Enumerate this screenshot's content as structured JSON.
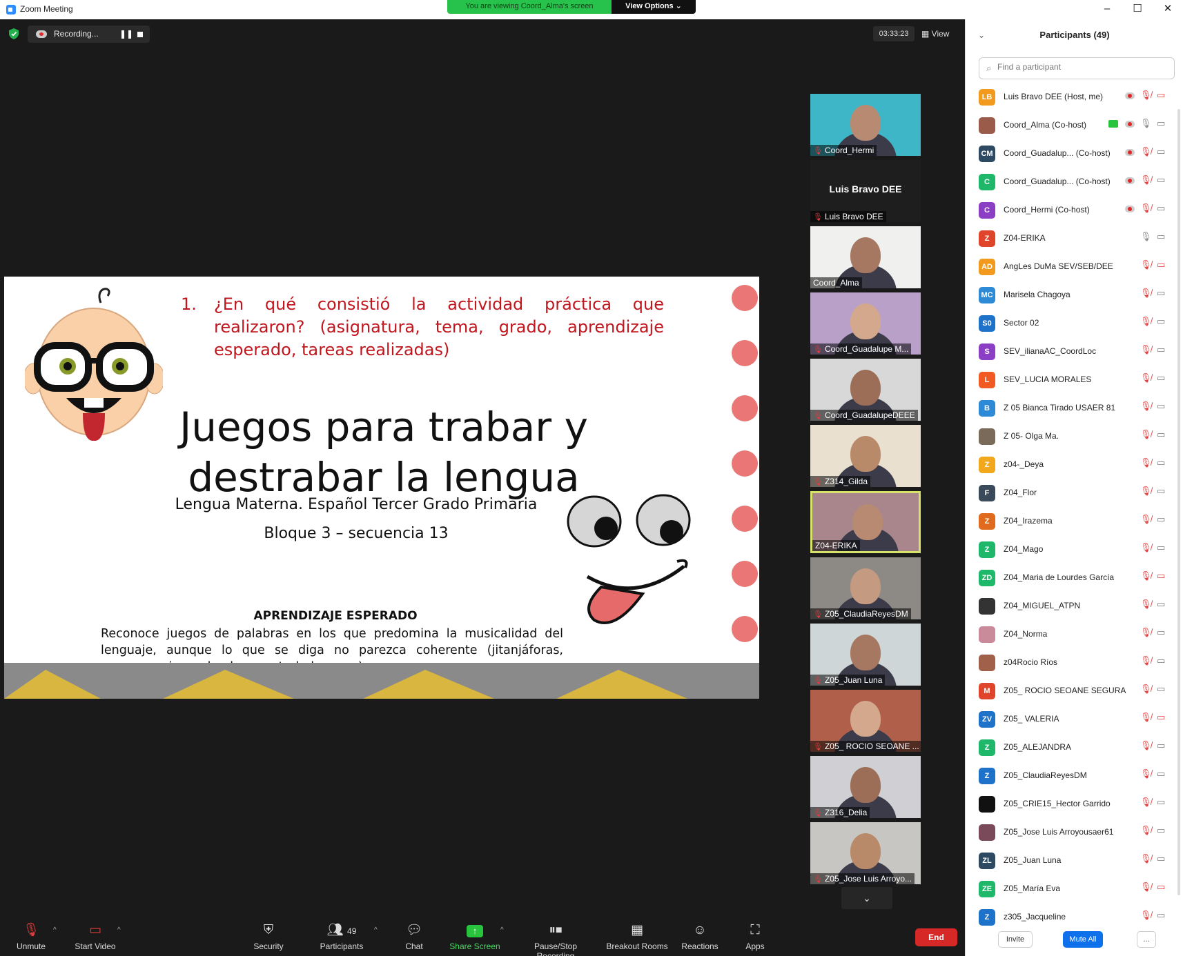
{
  "window": {
    "title": "Zoom Meeting",
    "controls": [
      "–",
      "☐",
      "✕"
    ]
  },
  "banner": {
    "message": "You are viewing Coord_Alma's screen",
    "options_label": "View Options ⌄"
  },
  "meeting": {
    "recording_label": "Recording...",
    "pause_glyph": "❚❚",
    "timer": "03:33:23",
    "view_label": "View"
  },
  "slide": {
    "question_number": "1.",
    "question_text": "¿En qué consistió la actividad práctica que realizaron? (asignatura, tema, grado, aprendizaje esperado, tareas realizadas)",
    "title_line1": "Juegos para trabar y",
    "title_line2": "destrabar la lengua",
    "subtitle": "Lengua Materna. Español Tercer Grado Primaria",
    "block": "Bloque 3 – secuencia 13",
    "aprendizaje_heading": "APRENDIZAJE ESPERADO",
    "aprendizaje_body": "Reconoce juegos de palabras en los que predomina la musicalidad del lenguaje, aunque lo que se diga no parezca coherente (jitanjáforas, paranomasias, calambures y trabalenguas)."
  },
  "video_tiles": [
    {
      "name": "Coord_Hermi",
      "muted": true
    },
    {
      "name": "Luis Bravo DEE",
      "muted": true,
      "display_name": "Luis Bravo DEE"
    },
    {
      "name": "Coord_Alma",
      "muted": false
    },
    {
      "name": "Coord_Guadalupe M...",
      "muted": true
    },
    {
      "name": "Coord_GuadalupeDEEE",
      "muted": true
    },
    {
      "name": "Z314_Gilda",
      "muted": true
    },
    {
      "name": "Z04-ERIKA",
      "muted": false
    },
    {
      "name": "Z05_ClaudiaReyesDM",
      "muted": true
    },
    {
      "name": "Z05_Juan Luna",
      "muted": true
    },
    {
      "name": "Z05_ ROCIO SEOANE ...",
      "muted": true
    },
    {
      "name": "Z316_Delia",
      "muted": true
    },
    {
      "name": "Z05_Jose Luis Arroyo...",
      "muted": true
    }
  ],
  "toolbar": {
    "unmute": "Unmute",
    "start_video": "Start Video",
    "security": "Security",
    "participants": "Participants",
    "participants_count": "49",
    "chat": "Chat",
    "share_screen": "Share Screen",
    "pause_recording": "Pause/Stop Recording",
    "breakout_rooms": "Breakout Rooms",
    "reactions": "Reactions",
    "apps": "Apps",
    "end": "End"
  },
  "participants_panel": {
    "title": "Participants (49)",
    "search_placeholder": "Find a participant",
    "invite": "Invite",
    "mute_all": "Mute All",
    "more": "...",
    "participants": [
      {
        "initials": "LB",
        "color": "#f29a1d",
        "name": "Luis Bravo DEE (Host, me)",
        "recording": true,
        "mic": "off",
        "cam": "off"
      },
      {
        "initials": "",
        "color": "#9b5b4a",
        "name": "Coord_Alma (Co-host)",
        "recording": true,
        "sharing": true,
        "mic": "on",
        "cam": "on"
      },
      {
        "initials": "CM",
        "color": "#2d4a62",
        "name": "Coord_Guadalup...  (Co-host)",
        "recording": true,
        "mic": "off",
        "cam": "on"
      },
      {
        "initials": "C",
        "color": "#1fb86a",
        "name": "Coord_Guadalup...  (Co-host)",
        "recording": true,
        "mic": "off",
        "cam": "on"
      },
      {
        "initials": "C",
        "color": "#8a3fc5",
        "name": "Coord_Hermi (Co-host)",
        "recording": true,
        "mic": "off",
        "cam": "on"
      },
      {
        "initials": "Z",
        "color": "#e0452b",
        "name": "Z04-ERIKA",
        "mic": "on",
        "cam": "on"
      },
      {
        "initials": "AD",
        "color": "#f29a1d",
        "name": "AngLes DuMa SEV/SEB/DEE",
        "mic": "off",
        "cam": "off"
      },
      {
        "initials": "MC",
        "color": "#2d8ad6",
        "name": "Marisela Chagoya",
        "mic": "off",
        "cam": "on"
      },
      {
        "initials": "S0",
        "color": "#1f72c9",
        "name": "Sector 02",
        "mic": "off",
        "cam": "on"
      },
      {
        "initials": "S",
        "color": "#8a3fc5",
        "name": "SEV_ilianaAC_CoordLoc",
        "mic": "off",
        "cam": "on"
      },
      {
        "initials": "L",
        "color": "#f25a24",
        "name": "SEV_LUCIA MORALES",
        "mic": "off",
        "cam": "on"
      },
      {
        "initials": "B",
        "color": "#2d8ad6",
        "name": "Z 05 Bianca Tirado USAER 81",
        "mic": "off",
        "cam": "on"
      },
      {
        "initials": "",
        "color": "#7a6a5a",
        "name": "Z 05- Olga Ma.",
        "mic": "off",
        "cam": "on"
      },
      {
        "initials": "Z",
        "color": "#f2a81d",
        "name": "z04-_Deya",
        "mic": "off",
        "cam": "on"
      },
      {
        "initials": "F",
        "color": "#3a4a5a",
        "name": "Z04_Flor",
        "mic": "off",
        "cam": "on"
      },
      {
        "initials": "Z",
        "color": "#e06a1d",
        "name": "Z04_Irazema",
        "mic": "off",
        "cam": "on"
      },
      {
        "initials": "Z",
        "color": "#1fb86a",
        "name": "Z04_Mago",
        "mic": "off",
        "cam": "on"
      },
      {
        "initials": "ZD",
        "color": "#1fb86a",
        "name": "Z04_Maria de Lourdes García",
        "mic": "off",
        "cam": "off"
      },
      {
        "initials": "",
        "color": "#333333",
        "name": "Z04_MIGUEL_ATPN",
        "mic": "off",
        "cam": "on"
      },
      {
        "initials": "",
        "color": "#c98a9a",
        "name": "Z04_Norma",
        "mic": "off",
        "cam": "on"
      },
      {
        "initials": "",
        "color": "#a0604a",
        "name": "z04Rocio Ríos",
        "mic": "off",
        "cam": "on"
      },
      {
        "initials": "M",
        "color": "#e0452b",
        "name": "Z05_ ROCIO SEOANE SEGURA",
        "mic": "off",
        "cam": "on"
      },
      {
        "initials": "ZV",
        "color": "#1f72c9",
        "name": "Z05_ VALERIA",
        "mic": "off",
        "cam": "off"
      },
      {
        "initials": "Z",
        "color": "#1fb86a",
        "name": "Z05_ALEJANDRA",
        "mic": "off",
        "cam": "on"
      },
      {
        "initials": "Z",
        "color": "#1f72c9",
        "name": "Z05_ClaudiaReyesDM",
        "mic": "off",
        "cam": "on"
      },
      {
        "initials": "",
        "color": "#111111",
        "name": "Z05_CRIE15_Hector Garrido",
        "mic": "off",
        "cam": "on"
      },
      {
        "initials": "",
        "color": "#7a4a5a",
        "name": "Z05_Jose Luis Arroyousaer61",
        "mic": "off",
        "cam": "on"
      },
      {
        "initials": "ZL",
        "color": "#2d4a62",
        "name": "Z05_Juan Luna",
        "mic": "off",
        "cam": "on"
      },
      {
        "initials": "ZE",
        "color": "#1fb86a",
        "name": "Z05_María Eva",
        "mic": "off",
        "cam": "off"
      },
      {
        "initials": "Z",
        "color": "#1f72c9",
        "name": "z305_Jacqueline",
        "mic": "off",
        "cam": "on"
      }
    ]
  }
}
